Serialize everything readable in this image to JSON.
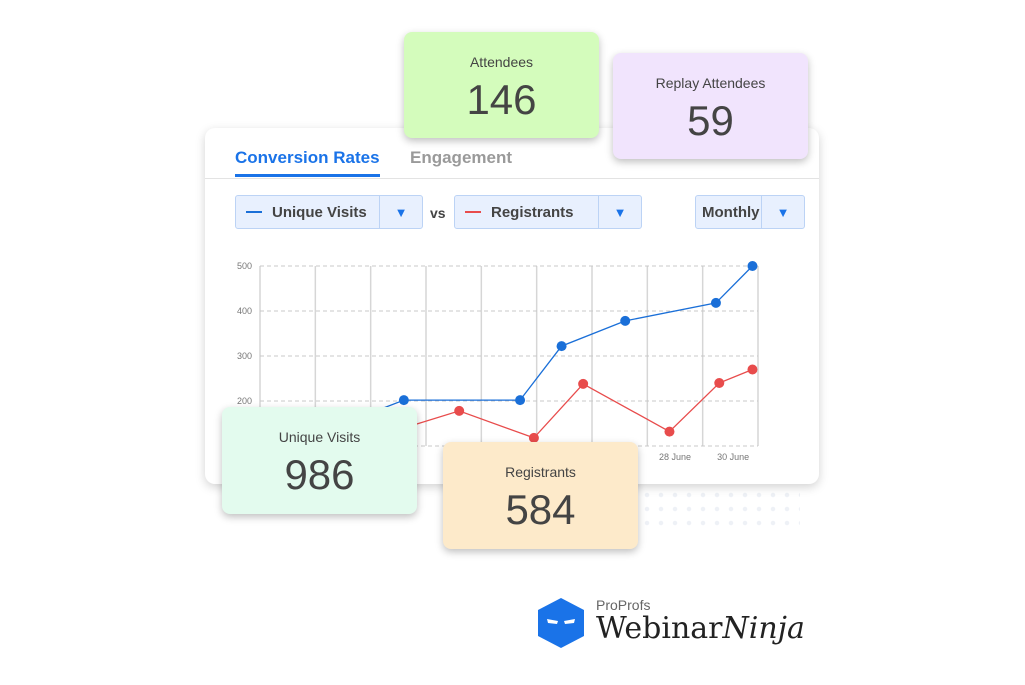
{
  "tabs": [
    {
      "label": "Conversion Rates",
      "active": true
    },
    {
      "label": "Engagement",
      "active": false
    }
  ],
  "filters": {
    "metric1": "Unique Visits",
    "vs": "vs",
    "metric2": "Registrants",
    "period": "Monthly",
    "arrow_icon": "triangle-down-icon"
  },
  "cards": {
    "attendees": {
      "label": "Attendees",
      "value": "146",
      "color": "#d4fcbc"
    },
    "replay": {
      "label": "Replay Attendees",
      "value": "59",
      "color": "#f1e4fd"
    },
    "unique": {
      "label": "Unique Visits",
      "value": "986",
      "color": "#e3fbee"
    },
    "registrants": {
      "label": "Registrants",
      "value": "584",
      "color": "#fdeaca"
    }
  },
  "chart_data": {
    "type": "line",
    "ylim": [
      100,
      500
    ],
    "yticks": [
      200,
      300,
      400,
      500
    ],
    "xlim": [
      0,
      9
    ],
    "xticks": [
      {
        "x": 7.5,
        "label": "28 June"
      },
      {
        "x": 8.55,
        "label": "30 June"
      }
    ],
    "grid": true,
    "series": [
      {
        "color": "#1a6fd8",
        "points": [
          [
            1.5,
            150
          ],
          [
            2.6,
            202
          ],
          [
            4.7,
            202
          ],
          [
            5.45,
            322
          ],
          [
            6.6,
            378
          ],
          [
            8.24,
            418
          ],
          [
            8.9,
            500
          ]
        ]
      },
      {
        "color": "#e84c4c",
        "points": [
          [
            2.6,
            140
          ],
          [
            3.6,
            178
          ],
          [
            4.95,
            118
          ],
          [
            5.84,
            238
          ],
          [
            7.4,
            132
          ],
          [
            8.3,
            240
          ],
          [
            8.9,
            270
          ]
        ]
      }
    ]
  },
  "logo": {
    "brand": "ProProfs",
    "product": "Webinar",
    "product_italic": "Ninja"
  }
}
